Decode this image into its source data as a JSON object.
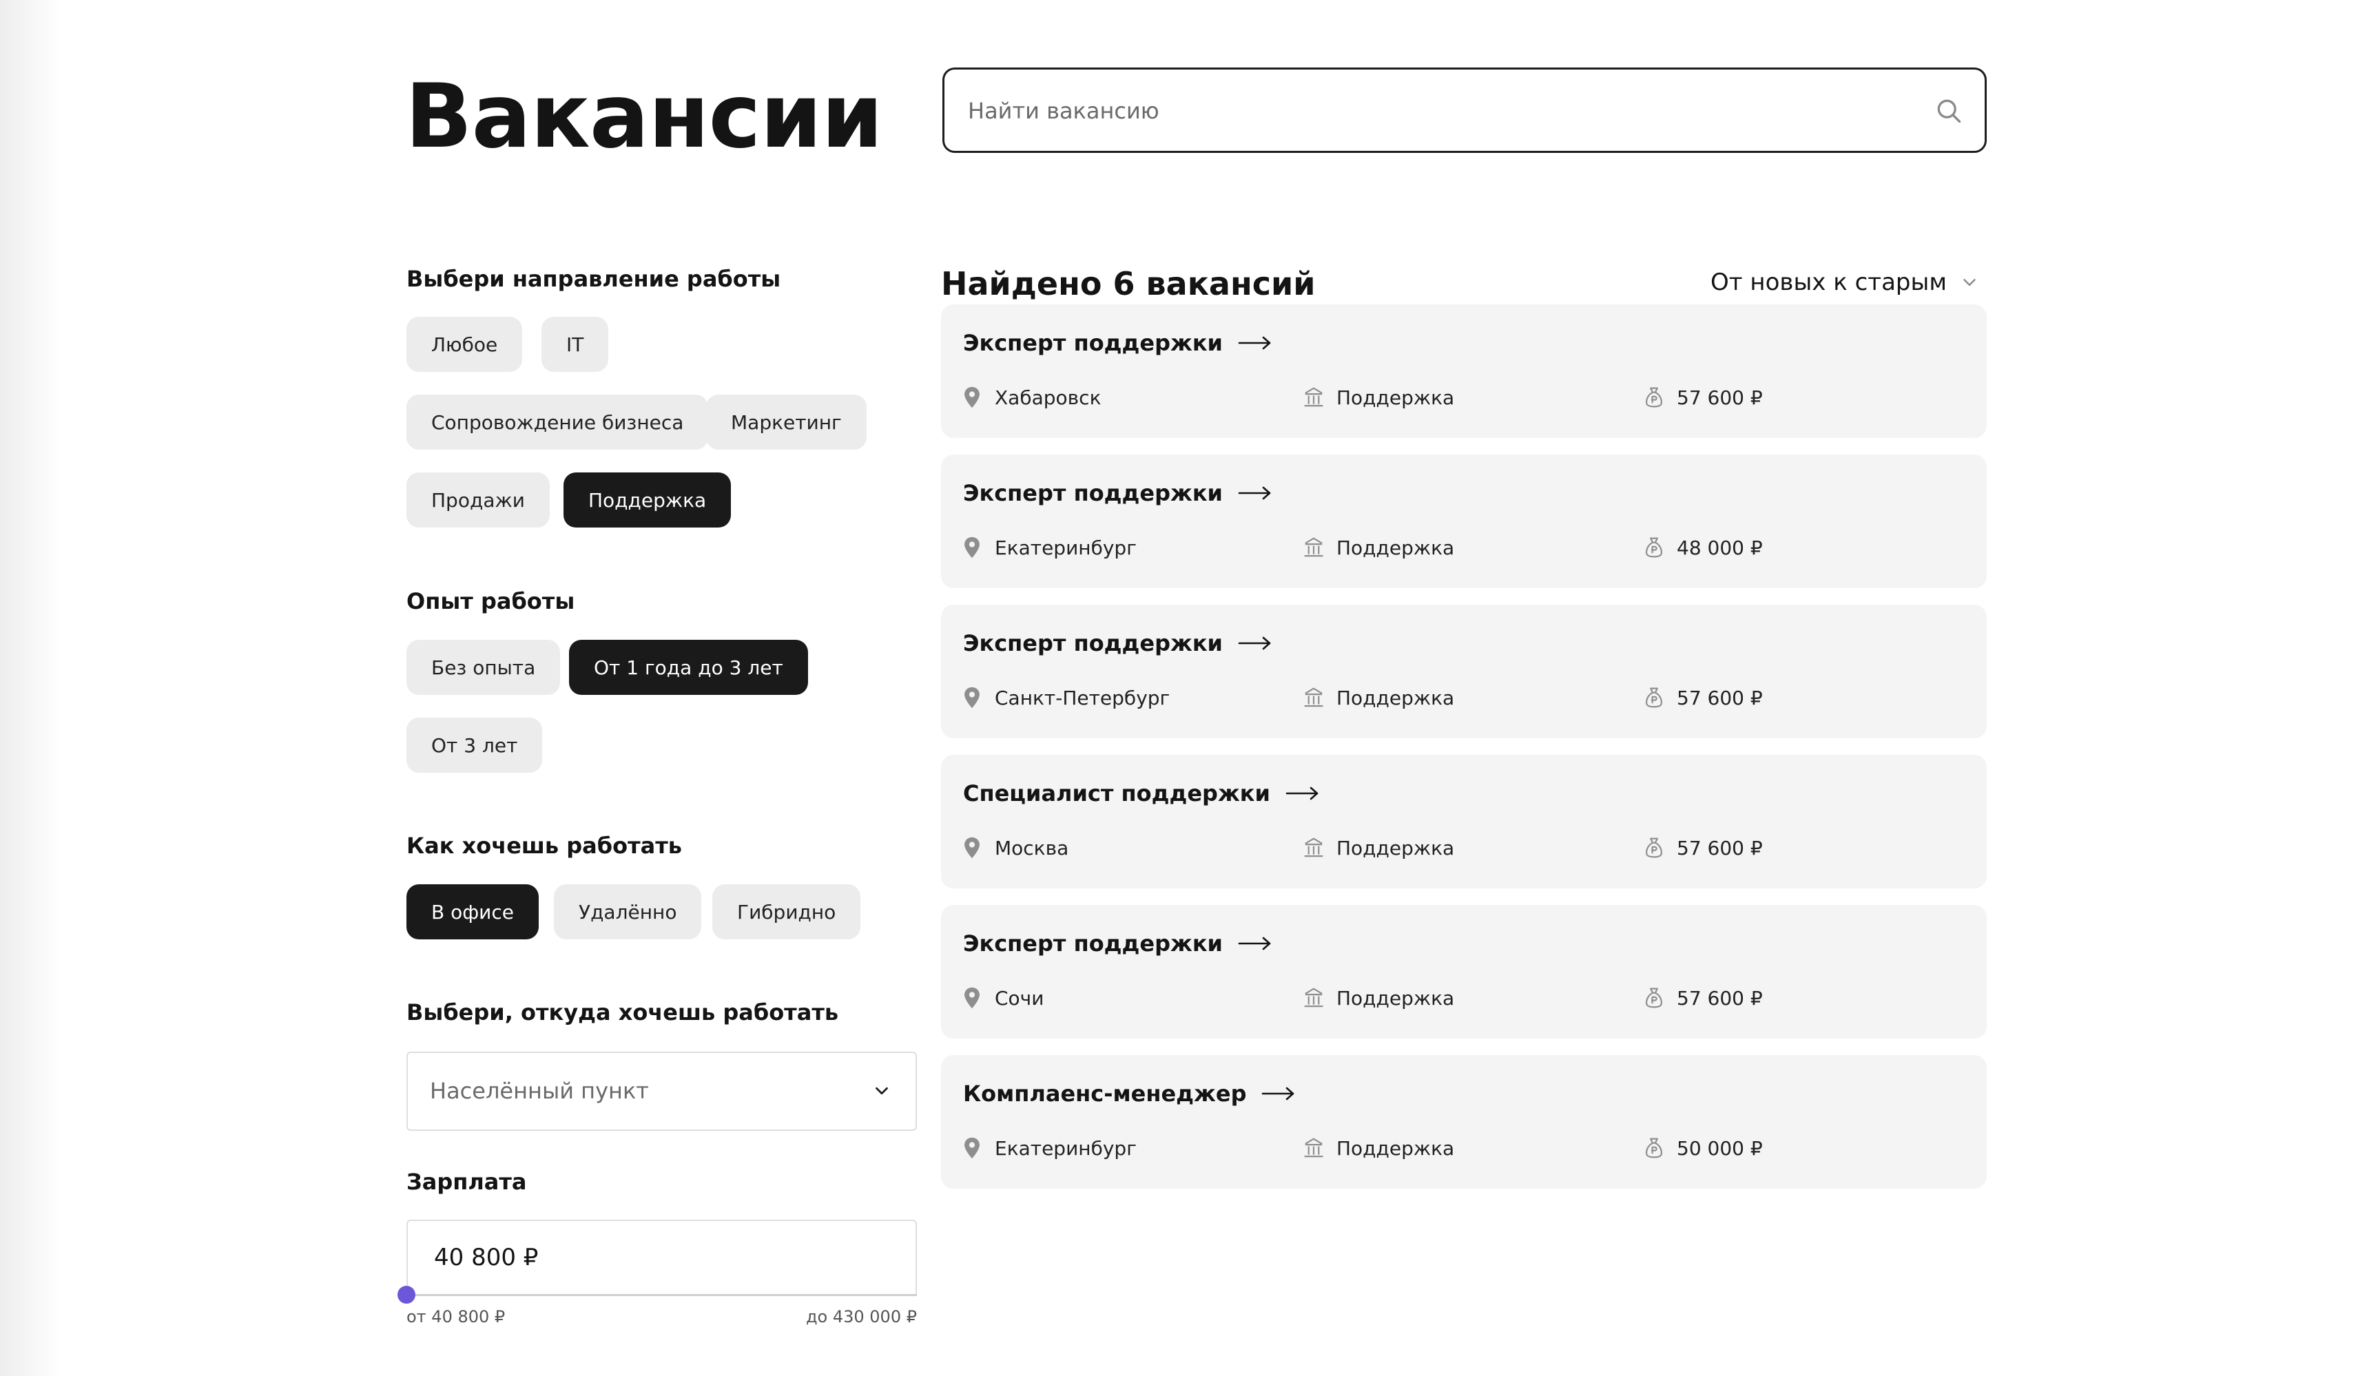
{
  "page": {
    "title": "Вакансии",
    "search_placeholder": "Найти вакансию"
  },
  "filters": {
    "direction": {
      "title": "Выбери направление работы",
      "options": [
        {
          "label": "Любое",
          "active": false
        },
        {
          "label": "IT",
          "active": false
        },
        {
          "label": "Сопровождение бизнеса",
          "active": false
        },
        {
          "label": "Маркетинг",
          "active": false
        },
        {
          "label": "Продажи",
          "active": false
        },
        {
          "label": "Поддержка",
          "active": true
        }
      ]
    },
    "experience": {
      "title": "Опыт работы",
      "options": [
        {
          "label": "Без опыта",
          "active": false
        },
        {
          "label": "От 1 года до 3 лет",
          "active": true
        },
        {
          "label": "От 3 лет",
          "active": false
        }
      ]
    },
    "work_format": {
      "title": "Как хочешь работать",
      "options": [
        {
          "label": "В офисе",
          "active": true
        },
        {
          "label": "Удалённо",
          "active": false
        },
        {
          "label": "Гибридно",
          "active": false
        }
      ]
    },
    "location": {
      "title": "Выбери, откуда хочешь работать",
      "placeholder": "Населённый пункт"
    },
    "salary": {
      "title": "Зарплата",
      "value": "40 800 ₽",
      "min_label": "от 40 800 ₽",
      "max_label": "до 430 000 ₽",
      "slider_fraction": 0
    }
  },
  "results": {
    "count_label": "Найдено 6 вакансий",
    "sort_label": "От новых к старым",
    "vacancies": [
      {
        "title": "Эксперт поддержки",
        "city": "Хабаровск",
        "department": "Поддержка",
        "salary": "57 600 ₽"
      },
      {
        "title": "Эксперт поддержки",
        "city": "Екатеринбург",
        "department": "Поддержка",
        "salary": "48 000 ₽"
      },
      {
        "title": "Эксперт поддержки",
        "city": "Санкт-Петербург",
        "department": "Поддержка",
        "salary": "57 600 ₽"
      },
      {
        "title": "Специалист поддержки",
        "city": "Москва",
        "department": "Поддержка",
        "salary": "57 600 ₽"
      },
      {
        "title": "Эксперт поддержки",
        "city": "Сочи",
        "department": "Поддержка",
        "salary": "57 600 ₽"
      },
      {
        "title": "Комплаенс-менеджер",
        "city": "Екатеринбург",
        "department": "Поддержка",
        "salary": "50 000 ₽"
      }
    ]
  },
  "icons": {
    "search": "search-icon",
    "city": "map-pin-icon",
    "department": "building-icon",
    "salary": "money-bag-icon",
    "sort_toggle": "chevron-down-icon",
    "select_toggle": "chevron-down-icon",
    "vacancy_link": "arrow-right-icon"
  },
  "colors": {
    "accent": "#6c57d8",
    "active_chip": "#1a1a1a",
    "chip": "#ececec",
    "card": "#f4f4f4"
  }
}
